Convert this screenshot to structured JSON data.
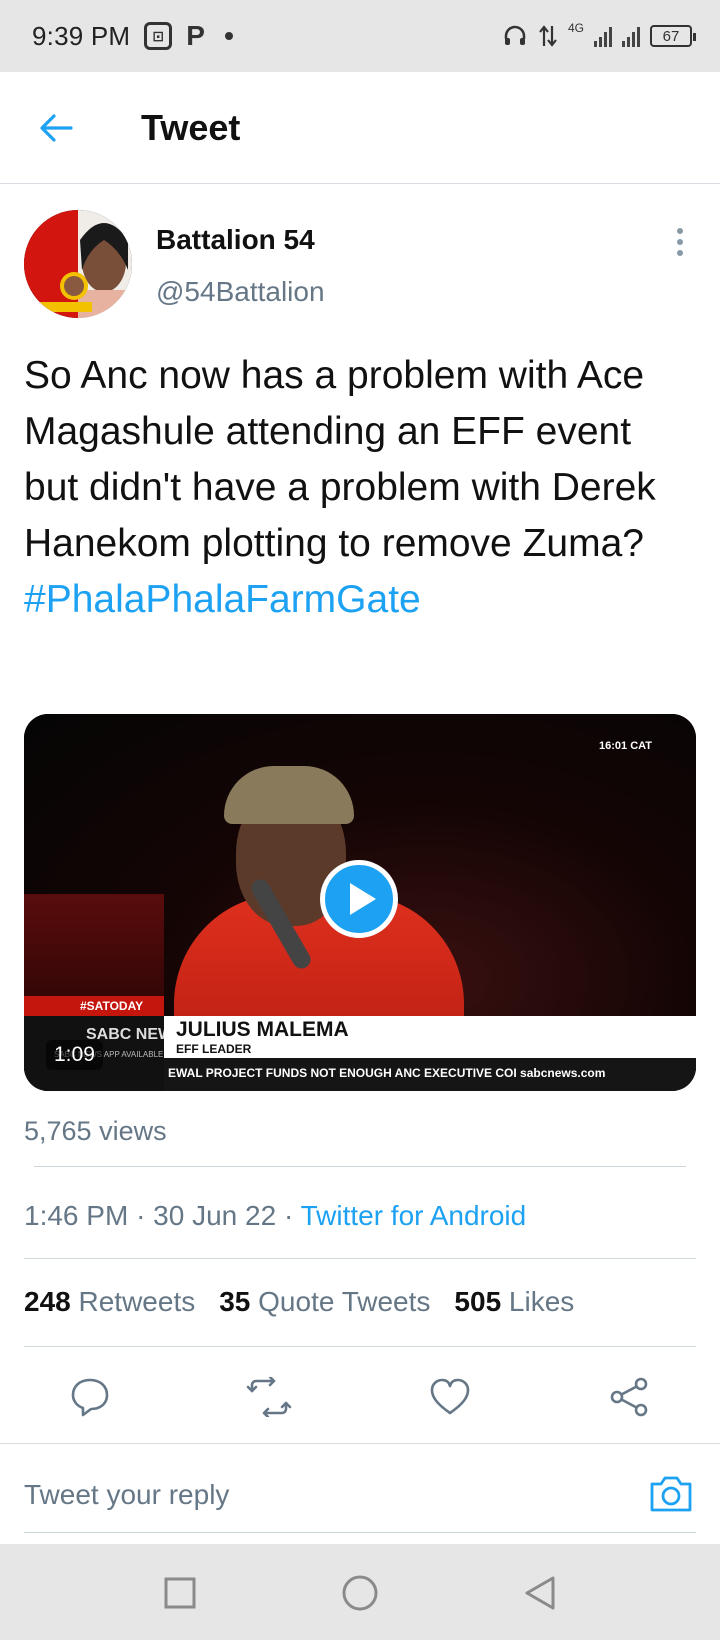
{
  "status_bar": {
    "time": "9:39 PM",
    "network_label": "4G",
    "battery_level": "67"
  },
  "header": {
    "title": "Tweet"
  },
  "author": {
    "name": "Battalion 54",
    "handle": "@54Battalion"
  },
  "tweet": {
    "text": "So Anc now has a problem with Ace Magashule attending an EFF event but didn't have a problem with Derek Hanekom plotting to remove Zuma?",
    "hashtag": "#PhalaPhalaFarmGate"
  },
  "media": {
    "duration": "1:09",
    "broadcast_time": "16:01 CAT",
    "overlay_tag": "#SATODAY",
    "logo_text": "SABC NEWS",
    "logo_subtext": "SABC NEWS APP AVAILABLE NOW",
    "lower_third_name": "JULIUS MALEMA",
    "lower_third_title": "EFF LEADER",
    "ticker_text": "EWAL PROJECT FUNDS NOT ENOUGH  ANC EXECUTIVE COI  sabcnews.com"
  },
  "views": "5,765 views",
  "meta": {
    "time": "1:46 PM",
    "date": "30 Jun 22",
    "separator": "·",
    "source": "Twitter for Android"
  },
  "stats": {
    "retweets_count": "248",
    "retweets_label": "Retweets",
    "quotes_count": "35",
    "quotes_label": "Quote Tweets",
    "likes_count": "505",
    "likes_label": "Likes"
  },
  "reply": {
    "placeholder": "Tweet your reply"
  },
  "colors": {
    "accent": "#1da1f2",
    "secondary_text": "#657786"
  }
}
